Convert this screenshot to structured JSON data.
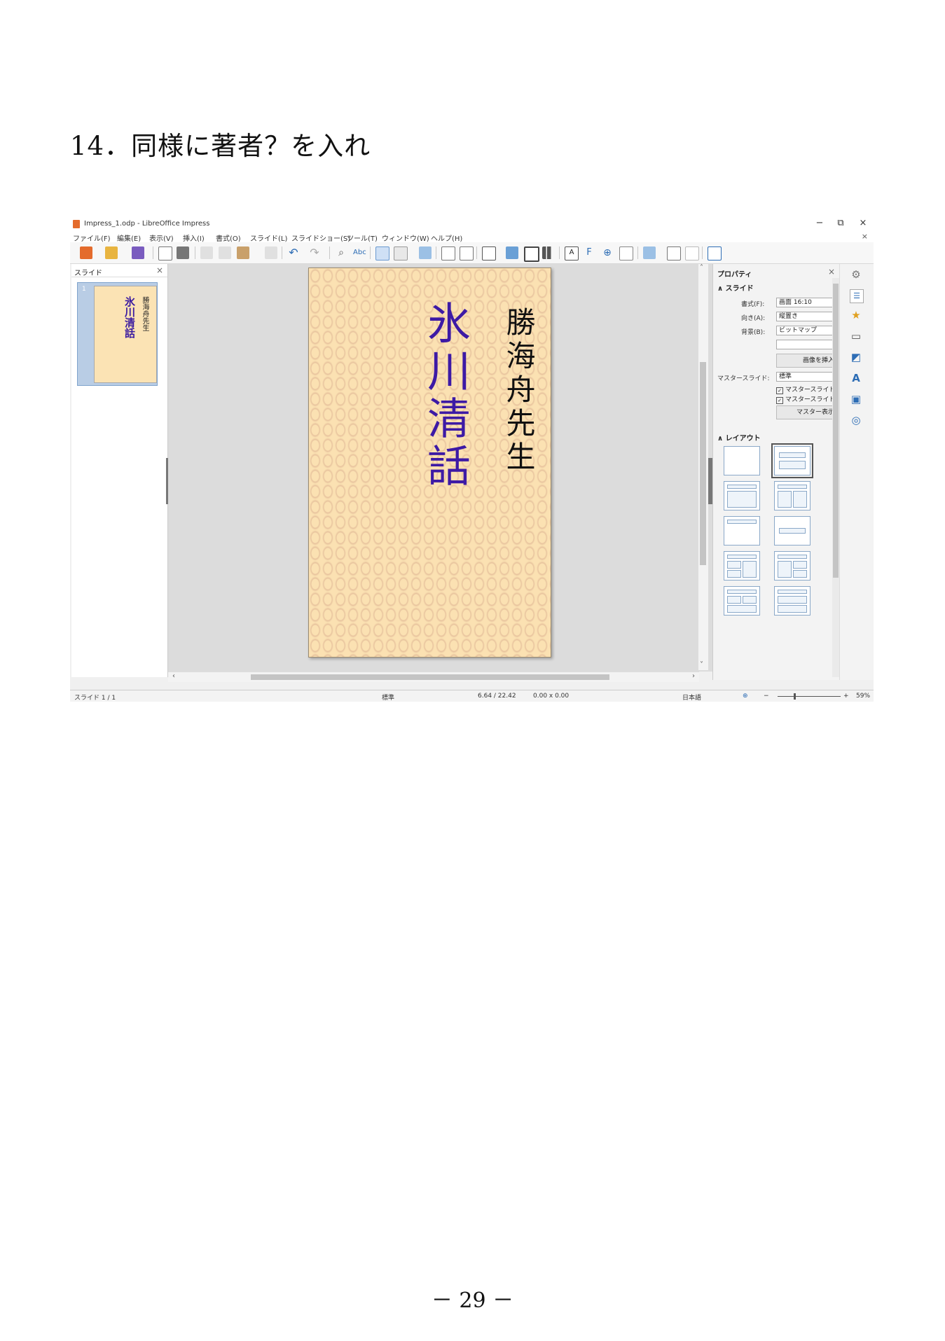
{
  "doc": {
    "heading": "14．同様に著者？を入れ",
    "page_number": "－ 29 －"
  },
  "window": {
    "title": "Impress_1.odp - LibreOffice Impress",
    "minimize": "−",
    "maximize": "⧉",
    "close": "×"
  },
  "menu": [
    "ファイル(F)",
    "編集(E)",
    "表示(V)",
    "挿入(I)",
    "書式(O)",
    "スライド(L)",
    "スライドショー(S)",
    "ツール(T)",
    "ウィンドウ(W)",
    "ヘルプ(H)"
  ],
  "menu_close": "×",
  "slides_panel": {
    "title": "スライド",
    "close": "×",
    "thumb_number": "1",
    "thumb_title": "氷川清話",
    "thumb_author": "勝海舟先生"
  },
  "slide": {
    "title": "氷川清話",
    "author": "勝海舟先生"
  },
  "properties": {
    "title": "プロパティ",
    "close": "×",
    "section_slide": "スライド",
    "format_label": "書式(F):",
    "format_value": "画面 16:10",
    "orientation_label": "向き(A):",
    "orientation_value": "縦置き",
    "background_label": "背景(B):",
    "background_value": "ビットマップ",
    "insert_image": "画像を挿入",
    "master_label": "マスタースライド:",
    "master_value": "標準",
    "check1": "マスタースライドの背景",
    "check2": "マスタースライドのオブジェクト",
    "master_button": "マスター表示",
    "section_layout": "レイアウト"
  },
  "statusbar": {
    "slide_pos": "スライド 1 / 1",
    "master": "標準",
    "position": "6.64 / 22.42",
    "size": "0.00 x 0.00",
    "language": "日本語",
    "zoom_minus": "−",
    "zoom_plus": "+",
    "zoom": "59%"
  },
  "colors": {
    "slide_bg": "#fbe1b2",
    "title_text": "#3d1aa5",
    "selection": "#b9cde5"
  }
}
